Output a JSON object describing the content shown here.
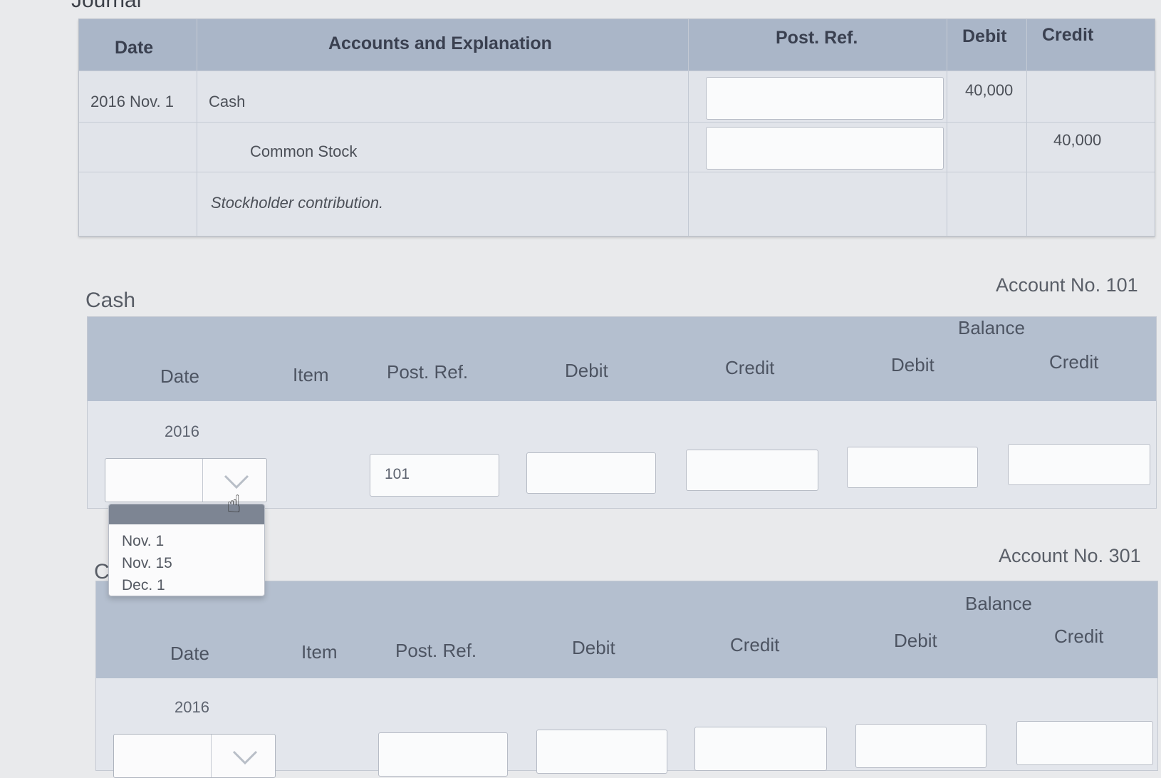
{
  "page": {
    "partial_title": "Journal"
  },
  "journal": {
    "headers": {
      "date": "Date",
      "accounts": "Accounts and Explanation",
      "post_ref": "Post. Ref.",
      "debit": "Debit",
      "credit": "Credit"
    },
    "rows": [
      {
        "date": "2016 Nov. 1",
        "account": "Cash",
        "post_ref": "",
        "debit": "40,000",
        "credit": ""
      },
      {
        "date": "",
        "account": "Common Stock",
        "post_ref": "",
        "debit": "",
        "credit": "40,000"
      },
      {
        "date": "",
        "account": "Stockholder contribution.",
        "post_ref": "",
        "debit": "",
        "credit": ""
      }
    ]
  },
  "cash_ledger": {
    "title": "Cash",
    "account_no": "Account No. 101",
    "balance_label": "Balance",
    "headers": {
      "date": "Date",
      "item": "Item",
      "post_ref": "Post. Ref.",
      "debit": "Debit",
      "credit": "Credit",
      "bal_debit": "Debit",
      "bal_credit": "Credit"
    },
    "year": "2016",
    "entry": {
      "date": "",
      "item": "",
      "post_ref": "101",
      "debit": "",
      "credit": "",
      "bal_debit": "",
      "bal_credit": ""
    },
    "dropdown_options": [
      "Nov. 1",
      "Nov. 15",
      "Dec. 1"
    ]
  },
  "stock_ledger": {
    "title_partial": "C",
    "account_no": "Account No. 301",
    "balance_label": "Balance",
    "headers": {
      "date": "Date",
      "item": "Item",
      "post_ref": "Post. Ref.",
      "debit": "Debit",
      "credit": "Credit",
      "bal_debit": "Debit",
      "bal_credit": "Credit"
    },
    "year": "2016"
  },
  "colors": {
    "header_bg": "#aab6c8",
    "table_bg": "#e1e4ea",
    "input_bg": "#fafbfc"
  }
}
